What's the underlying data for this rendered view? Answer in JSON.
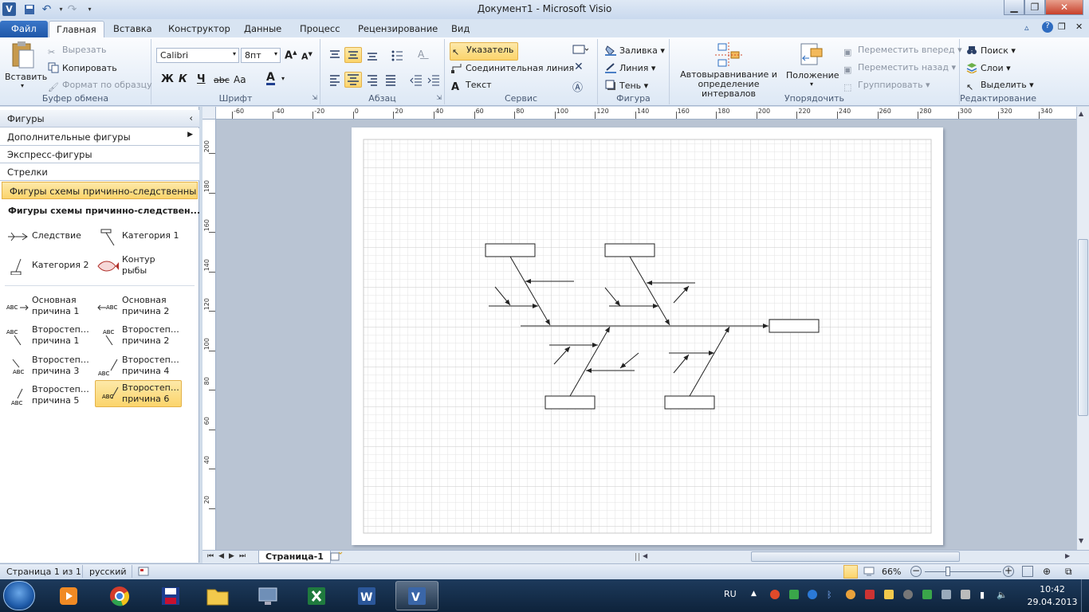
{
  "window": {
    "title": "Документ1 - Microsoft Visio"
  },
  "tabs": [
    {
      "label": "Файл"
    },
    {
      "label": "Главная"
    },
    {
      "label": "Вставка"
    },
    {
      "label": "Конструктор"
    },
    {
      "label": "Данные"
    },
    {
      "label": "Процесс"
    },
    {
      "label": "Рецензирование"
    },
    {
      "label": "Вид"
    }
  ],
  "ribbon": {
    "clipboard": {
      "label": "Буфер обмена",
      "paste": "Вставить",
      "cut": "Вырезать",
      "copy": "Копировать",
      "format_painter": "Формат по образцу"
    },
    "font": {
      "label": "Шрифт",
      "family": "Calibri",
      "size": "8пт",
      "bold": "Ж",
      "italic": "К",
      "underline": "Ч",
      "strike": "abc",
      "case": "Аа",
      "color": "A"
    },
    "paragraph": {
      "label": "Абзац"
    },
    "tools": {
      "label": "Сервис",
      "pointer": "Указатель",
      "connector": "Соединительная линия",
      "text": "Текст"
    },
    "shape": {
      "label": "Фигура",
      "fill": "Заливка",
      "line": "Линия",
      "shadow": "Тень"
    },
    "arrange": {
      "label": "Упорядочить",
      "autoalign": "Автовыравнивание и определение интервалов",
      "position": "Положение",
      "bring_forward": "Переместить вперед",
      "send_backward": "Переместить назад",
      "group": "Группировать"
    },
    "editing": {
      "label": "Редактирование",
      "find": "Поиск",
      "layers": "Слои",
      "select": "Выделить"
    }
  },
  "shapes_panel": {
    "title": "Фигуры",
    "more": "Дополнительные фигуры",
    "quick": "Экспресс-фигуры",
    "arrows": "Стрелки",
    "stencil_selected": "Фигуры схемы причинно-следственных с...",
    "stencil_header": "Фигуры схемы причинно-следствен...",
    "items": [
      {
        "l1": "Следствие",
        "l2": ""
      },
      {
        "l1": "Категория 1",
        "l2": ""
      },
      {
        "l1": "Категория 2",
        "l2": ""
      },
      {
        "l1": "Контур",
        "l2": "рыбы"
      },
      {
        "l1": "Основная",
        "l2": "причина 1"
      },
      {
        "l1": "Основная",
        "l2": "причина 2"
      },
      {
        "l1": "Второстепе...",
        "l2": "причина 1"
      },
      {
        "l1": "Второстепе...",
        "l2": "причина 2"
      },
      {
        "l1": "Второстепе...",
        "l2": "причина 3"
      },
      {
        "l1": "Второстепе...",
        "l2": "причина 4"
      },
      {
        "l1": "Второстепе...",
        "l2": "причина 5"
      },
      {
        "l1": "Второстепе...",
        "l2": "причина 6"
      }
    ]
  },
  "rulers": {
    "h": [
      "-60",
      "-40",
      "-20",
      "0",
      "20",
      "40",
      "60",
      "80",
      "100",
      "120",
      "140",
      "160",
      "180",
      "200",
      "220",
      "240",
      "260",
      "280",
      "300",
      "320",
      "340"
    ],
    "v": [
      "200",
      "180",
      "160",
      "140",
      "120",
      "100",
      "80",
      "60",
      "40",
      "20"
    ]
  },
  "pagebar": {
    "tab": "Страница-1"
  },
  "status": {
    "page": "Страница 1 из 1",
    "language": "русский",
    "zoom": "66%"
  },
  "taskbar": {
    "lang": "RU",
    "time": "10:42",
    "date": "29.04.2013"
  },
  "colors": {
    "accent": "#2b579a",
    "selected": "#fbd46b",
    "ribbon": "#dde8f5"
  }
}
